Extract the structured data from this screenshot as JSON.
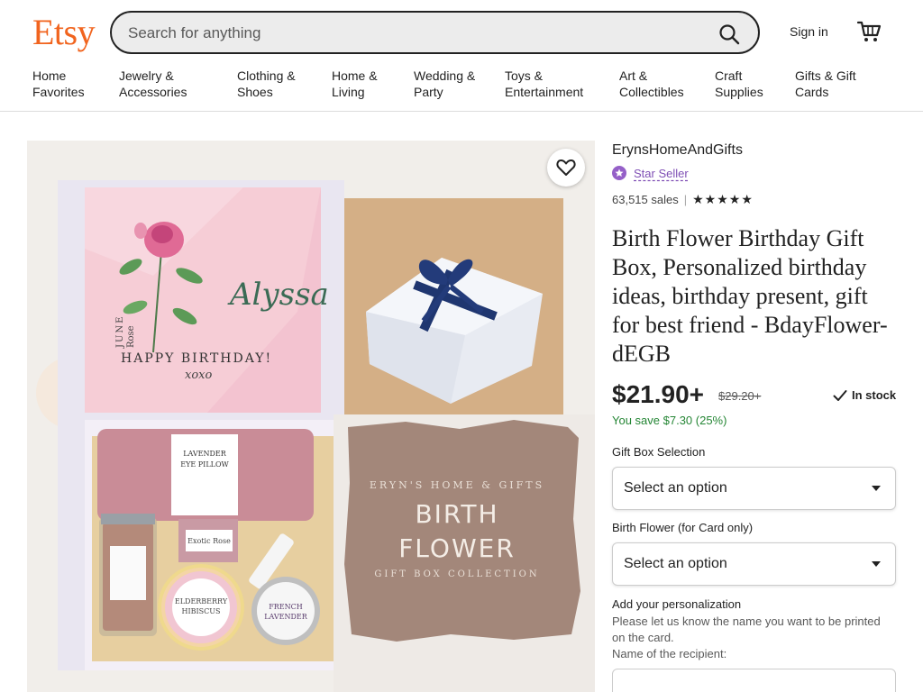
{
  "header": {
    "logo": "Etsy",
    "search_placeholder": "Search for anything",
    "signin": "Sign in"
  },
  "nav": [
    {
      "line1": "Home",
      "line2": "Favorites"
    },
    {
      "line1": "Jewelry &",
      "line2": "Accessories"
    },
    {
      "line1": "Clothing &",
      "line2": "Shoes"
    },
    {
      "line1": "Home &",
      "line2": "Living"
    },
    {
      "line1": "Wedding &",
      "line2": "Party"
    },
    {
      "line1": "Toys &",
      "line2": "Entertainment"
    },
    {
      "line1": "Art &",
      "line2": "Collectibles"
    },
    {
      "line1": "Craft",
      "line2": "Supplies"
    },
    {
      "line1": "Gifts & Gift",
      "line2": "Cards"
    }
  ],
  "gallery": {
    "card_name": "Alyssa",
    "card_month": "JUNE",
    "card_flower": "Rose",
    "card_greeting": "HAPPY BIRTHDAY!",
    "card_signoff": "xoxo",
    "pillow_label": "LAVENDER\nEYE PILLOW",
    "soap_label": "Exotic Rose",
    "balm_label": "ELDERBERRY\nHIBISCUS",
    "candle_label": "FRENCH\nLAVENDER",
    "brand_line": "ERYN'S HOME & GIFTS",
    "collection_title_1": "BIRTH",
    "collection_title_2": "FLOWER",
    "collection_subtitle": "GIFT BOX COLLECTION"
  },
  "listing": {
    "shop_name": "ErynsHomeAndGifts",
    "star_seller": "Star Seller",
    "sales": "63,515 sales",
    "rating_stars": "★★★★★",
    "title": "Birth Flower Birthday Gift Box, Personalized birthday ideas, birthday present, gift for best friend - BdayFlower-dEGB",
    "price": "$21.90+",
    "original_price": "$29.20+",
    "stock": "In stock",
    "savings": "You save $7.30 (25%)",
    "gift_box_label": "Gift Box Selection",
    "gift_box_value": "Select an option",
    "birth_flower_label": "Birth Flower (for Card only)",
    "birth_flower_value": "Select an option",
    "personalization_heading": "Add your personalization",
    "personalization_help": "Please let us know the name you want to be printed on the card.",
    "personalization_field": "Name of the recipient:"
  },
  "colors": {
    "brand": "#f1641e",
    "star_seller": "#7f4fb5",
    "savings": "#258635"
  }
}
